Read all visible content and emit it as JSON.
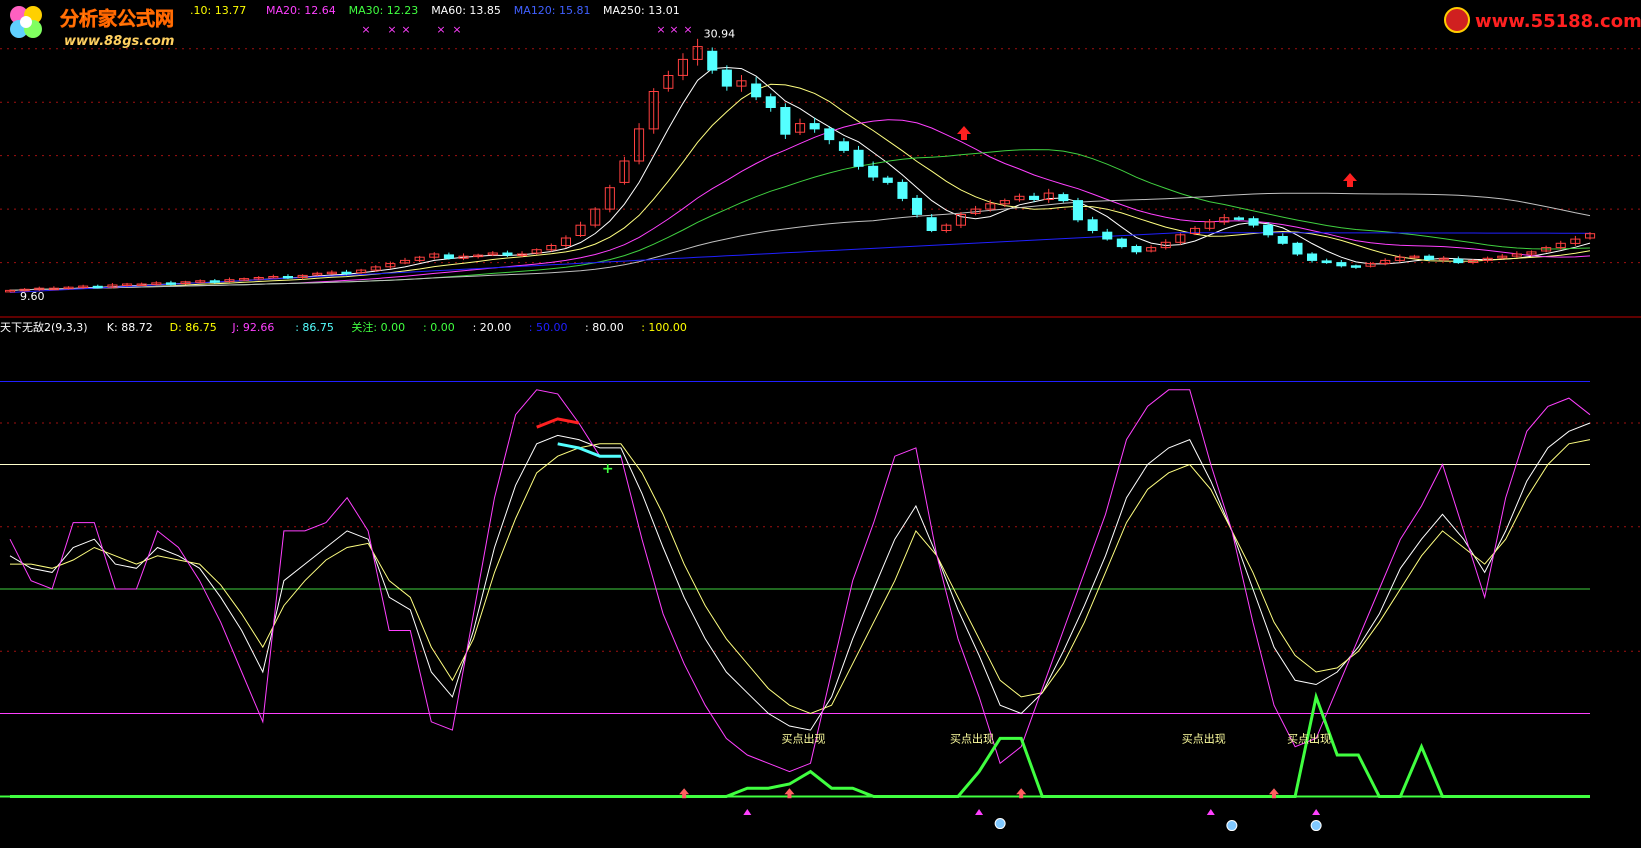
{
  "colors": {
    "bg": "#000000",
    "up": "#ff4040",
    "down": "#54ffff",
    "white_line": "#ffffff",
    "yellow_line": "#ffff80",
    "magenta_line": "#ff40ff",
    "green_line": "#40d040",
    "blue_line": "#2020ff",
    "ma250": "#c0c0c0",
    "bright_green": "#40ff40",
    "dash_red": "#a01010"
  },
  "watermark_left": {
    "title": "分析家公式网",
    "url": "www.88gs.com"
  },
  "watermark_right": {
    "url": "www.55188.com"
  },
  "price_panel": {
    "legend": [
      {
        "text": ".10: 13.77",
        "color": "#ffff00"
      },
      {
        "text": "MA20: 12.64",
        "color": "#ff40ff"
      },
      {
        "text": "MA30: 12.23",
        "color": "#40ff40"
      },
      {
        "text": "MA60: 13.85",
        "color": "#ffffff"
      },
      {
        "text": "MA120: 15.81",
        "color": "#4060ff"
      },
      {
        "text": "MA250: 13.01",
        "color": "#ffffff"
      }
    ],
    "high_label": "30.94",
    "low_label": "9.60"
  },
  "indicator_panel": {
    "legend": [
      {
        "text": "天下无敌2(9,3,3)",
        "color": "#ffffff"
      },
      {
        "text": "K: 88.72",
        "color": "#ffffff"
      },
      {
        "text": "D: 86.75",
        "color": "#ffff00"
      },
      {
        "text": "J: 92.66",
        "color": "#ff40ff"
      },
      {
        "text": ": 86.75",
        "color": "#54ffff"
      },
      {
        "text": "关注: 0.00",
        "color": "#40ff40"
      },
      {
        "text": ": 0.00",
        "color": "#40ff40"
      },
      {
        "text": ": 20.00",
        "color": "#ffffff"
      },
      {
        "text": ": 50.00",
        "color": "#2020ff"
      },
      {
        "text": ": 80.00",
        "color": "#ffffff"
      },
      {
        "text": ": 100.00",
        "color": "#ffff00"
      }
    ],
    "buy_label": "买点出现"
  },
  "chart_data": [
    {
      "type": "candlestick",
      "title": "",
      "ohlc_close_approx": [
        7.4,
        7.5,
        7.6,
        7.6,
        7.7,
        7.8,
        7.7,
        7.9,
        8.0,
        8.0,
        8.1,
        8.0,
        8.2,
        8.3,
        8.2,
        8.4,
        8.5,
        8.6,
        8.7,
        8.6,
        8.8,
        9.0,
        9.1,
        9.0,
        9.3,
        9.6,
        9.9,
        10.2,
        10.5,
        10.8,
        10.4,
        10.6,
        10.7,
        10.9,
        10.7,
        10.8,
        11.2,
        11.6,
        12.3,
        13.5,
        15.0,
        17.0,
        19.5,
        22.5,
        26.0,
        27.5,
        29.0,
        30.2,
        28.0,
        26.5,
        27.0,
        25.5,
        24.5,
        22.0,
        23.0,
        22.5,
        21.5,
        20.5,
        19.0,
        18.0,
        17.5,
        16.0,
        14.5,
        13.0,
        13.5,
        14.5,
        15.0,
        15.5,
        15.8,
        16.2,
        15.9,
        16.5,
        15.8,
        14.0,
        13.0,
        12.2,
        11.5,
        11.0,
        11.4,
        11.9,
        12.6,
        13.2,
        13.8,
        14.2,
        14.1,
        13.5,
        12.6,
        11.8,
        10.8,
        10.2,
        10.0,
        9.7,
        9.6,
        9.9,
        10.2,
        10.5,
        10.6,
        10.3,
        10.4,
        10.0,
        10.2,
        10.4,
        10.6,
        10.8,
        11.0,
        11.4,
        11.8,
        12.2,
        12.7
      ],
      "moving_averages": [
        "MA20",
        "MA30",
        "MA60",
        "MA120",
        "MA250"
      ]
    },
    {
      "type": "line",
      "title": "天下无敌2(9,3,3)",
      "series": [
        {
          "name": "K",
          "values": [
            58,
            55,
            54,
            60,
            62,
            56,
            55,
            60,
            58,
            55,
            48,
            40,
            30,
            52,
            56,
            60,
            64,
            62,
            48,
            45,
            30,
            24,
            40,
            60,
            75,
            85,
            87,
            86,
            84,
            84,
            73,
            60,
            48,
            38,
            30,
            25,
            20,
            17,
            16,
            24,
            38,
            50,
            62,
            70,
            58,
            45,
            34,
            22,
            20,
            25,
            35,
            46,
            58,
            72,
            80,
            84,
            86,
            76,
            64,
            50,
            36,
            28,
            27,
            30,
            36,
            44,
            55,
            62,
            68,
            62,
            54,
            64,
            76,
            84,
            88,
            90
          ]
        },
        {
          "name": "D",
          "values": [
            56,
            56,
            55,
            57,
            60,
            58,
            56,
            58,
            57,
            56,
            51,
            44,
            36,
            46,
            52,
            57,
            60,
            61,
            52,
            48,
            36,
            28,
            38,
            54,
            67,
            78,
            82,
            84,
            85,
            85,
            78,
            68,
            56,
            46,
            38,
            32,
            26,
            22,
            20,
            22,
            32,
            42,
            52,
            64,
            58,
            48,
            38,
            28,
            24,
            25,
            32,
            42,
            54,
            66,
            74,
            78,
            80,
            74,
            64,
            54,
            42,
            34,
            30,
            31,
            35,
            42,
            50,
            58,
            64,
            60,
            56,
            62,
            72,
            80,
            85,
            86
          ]
        },
        {
          "name": "J",
          "values": [
            62,
            52,
            50,
            66,
            66,
            50,
            50,
            64,
            60,
            52,
            42,
            30,
            18,
            64,
            64,
            66,
            72,
            64,
            40,
            40,
            18,
            16,
            44,
            72,
            92,
            98,
            97,
            90,
            82,
            82,
            62,
            44,
            32,
            22,
            14,
            10,
            8,
            6,
            8,
            30,
            52,
            66,
            82,
            84,
            58,
            38,
            24,
            8,
            12,
            26,
            40,
            54,
            68,
            86,
            94,
            98,
            98,
            80,
            64,
            42,
            22,
            12,
            14,
            26,
            38,
            50,
            62,
            70,
            80,
            64,
            48,
            72,
            88,
            94,
            96,
            92
          ]
        },
        {
          "name": "关注",
          "values": [
            0,
            0,
            0,
            0,
            0,
            0,
            0,
            0,
            0,
            0,
            0,
            0,
            0,
            0,
            0,
            0,
            0,
            0,
            0,
            0,
            0,
            0,
            0,
            0,
            0,
            0,
            0,
            0,
            0,
            0,
            0,
            0,
            0,
            0,
            0,
            2,
            2,
            3,
            6,
            2,
            2,
            0,
            0,
            0,
            0,
            0,
            6,
            14,
            14,
            0,
            0,
            0,
            0,
            0,
            0,
            0,
            0,
            0,
            0,
            0,
            0,
            0,
            24,
            10,
            10,
            0,
            0,
            12,
            0,
            0,
            0,
            0,
            0,
            0,
            0,
            0
          ]
        }
      ],
      "hlines": [
        0,
        20,
        50,
        80,
        100
      ],
      "ylim": [
        -10,
        110
      ]
    }
  ]
}
